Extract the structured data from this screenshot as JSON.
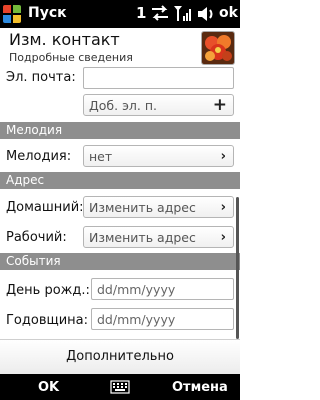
{
  "statusbar": {
    "title": "Пуск",
    "notification_count": "1",
    "ok_label": "ok"
  },
  "header": {
    "title": "Изм. контакт",
    "subtitle": "Подробные сведения"
  },
  "email": {
    "label": "Эл. почта:",
    "value": "",
    "add_label": "Доб. эл. п."
  },
  "sections": {
    "melody": "Мелодия",
    "address": "Адрес",
    "events": "События"
  },
  "melody_row": {
    "label": "Мелодия:",
    "value": "нет"
  },
  "address_rows": [
    {
      "label": "Домашний:",
      "button": "Изменить адрес"
    },
    {
      "label": "Рабочий:",
      "button": "Изменить адрес"
    }
  ],
  "events_rows": [
    {
      "label": "День рожд.:",
      "placeholder": "dd/mm/yyyy"
    },
    {
      "label": "Годовщина:",
      "placeholder": "dd/mm/yyyy"
    }
  ],
  "more_label": "Дополнительно",
  "softkeys": {
    "left": "OK",
    "right": "Отмена"
  },
  "icons": {
    "start": "windows-start-icon",
    "sync": "sync-icon",
    "signal": "signal-icon",
    "volume": "volume-icon",
    "avatar": "contact-photo",
    "chevron": "chevron-right-icon",
    "plus": "plus-icon",
    "keyboard": "keyboard-icon"
  },
  "colors": {
    "section_bg": "#8e8e8e",
    "bar_bg": "#000000"
  }
}
